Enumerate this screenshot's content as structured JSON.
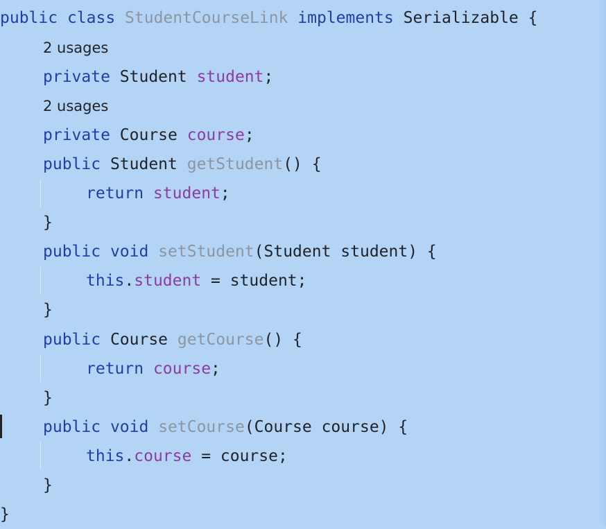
{
  "editor": {
    "background": "#b4d4f6",
    "colors": {
      "keyword": "#1f3fa7",
      "field": "#8b3da0",
      "unused_method": "#8b96a2",
      "default_text": "#1f2329"
    },
    "lines": [
      {
        "tokens": [
          {
            "text": "public",
            "kind": "keyword"
          },
          {
            "text": " class ",
            "kind": "keyword"
          },
          {
            "text": "StudentCourseLink",
            "kind": "unused"
          },
          {
            "text": " implements ",
            "kind": "keyword"
          },
          {
            "text": "Serializable {",
            "kind": "plain"
          }
        ]
      },
      {
        "hint": "2 usages"
      },
      {
        "tokens": [
          {
            "text": "private",
            "kind": "keyword"
          },
          {
            "text": " Student ",
            "kind": "plain"
          },
          {
            "text": "student",
            "kind": "field"
          },
          {
            "text": ";",
            "kind": "plain"
          }
        ]
      },
      {
        "hint": "2 usages"
      },
      {
        "tokens": [
          {
            "text": "private",
            "kind": "keyword"
          },
          {
            "text": " Course ",
            "kind": "plain"
          },
          {
            "text": "course",
            "kind": "field"
          },
          {
            "text": ";",
            "kind": "plain"
          }
        ]
      },
      {
        "tokens": [
          {
            "text": "public",
            "kind": "keyword"
          },
          {
            "text": " Student ",
            "kind": "plain"
          },
          {
            "text": "getStudent",
            "kind": "unused"
          },
          {
            "text": "() {",
            "kind": "plain"
          }
        ]
      },
      {
        "tokens": [
          {
            "text": "return",
            "kind": "keyword"
          },
          {
            "text": " ",
            "kind": "plain"
          },
          {
            "text": "student",
            "kind": "field"
          },
          {
            "text": ";",
            "kind": "plain"
          }
        ]
      },
      {
        "tokens": [
          {
            "text": "}",
            "kind": "plain"
          }
        ]
      },
      {
        "tokens": [
          {
            "text": "public",
            "kind": "keyword"
          },
          {
            "text": " void ",
            "kind": "keyword"
          },
          {
            "text": "setStudent",
            "kind": "unused"
          },
          {
            "text": "(Student student) {",
            "kind": "plain"
          }
        ]
      },
      {
        "tokens": [
          {
            "text": "this",
            "kind": "keyword"
          },
          {
            "text": ".",
            "kind": "plain"
          },
          {
            "text": "student",
            "kind": "field"
          },
          {
            "text": " = student;",
            "kind": "plain"
          }
        ]
      },
      {
        "tokens": [
          {
            "text": "}",
            "kind": "plain"
          }
        ]
      },
      {
        "tokens": [
          {
            "text": "public",
            "kind": "keyword"
          },
          {
            "text": " Course ",
            "kind": "plain"
          },
          {
            "text": "getCourse",
            "kind": "unused"
          },
          {
            "text": "() {",
            "kind": "plain"
          }
        ]
      },
      {
        "tokens": [
          {
            "text": "return",
            "kind": "keyword"
          },
          {
            "text": " ",
            "kind": "plain"
          },
          {
            "text": "course",
            "kind": "field"
          },
          {
            "text": ";",
            "kind": "plain"
          }
        ]
      },
      {
        "tokens": [
          {
            "text": "}",
            "kind": "plain"
          }
        ]
      },
      {
        "tokens": [
          {
            "text": "public",
            "kind": "keyword"
          },
          {
            "text": " void ",
            "kind": "keyword"
          },
          {
            "text": "setCourse",
            "kind": "unused"
          },
          {
            "text": "(Course course) {",
            "kind": "plain"
          }
        ]
      },
      {
        "tokens": [
          {
            "text": "this",
            "kind": "keyword"
          },
          {
            "text": ".",
            "kind": "plain"
          },
          {
            "text": "course",
            "kind": "field"
          },
          {
            "text": " = course;",
            "kind": "plain"
          }
        ]
      },
      {
        "tokens": [
          {
            "text": "}",
            "kind": "plain"
          }
        ]
      },
      {
        "tokens": [
          {
            "text": "}",
            "kind": "plain"
          }
        ]
      }
    ]
  }
}
